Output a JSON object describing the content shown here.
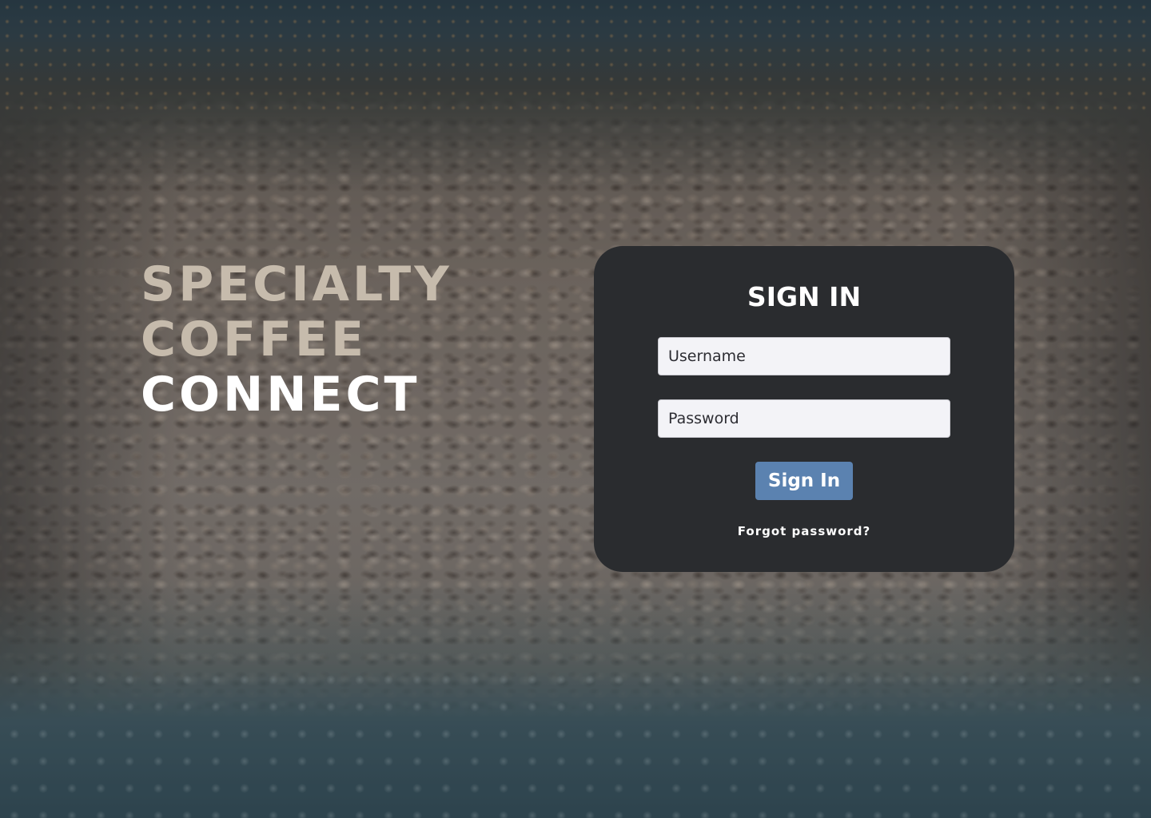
{
  "brand": {
    "line1": "SPECIALTY",
    "line2": "COFFEE",
    "line3": "CONNECT"
  },
  "login": {
    "title": "SIGN IN",
    "username_placeholder": "Username",
    "password_placeholder": "Password",
    "submit_label": "Sign In",
    "forgot_label": "Forgot password?"
  },
  "colors": {
    "card_background": "#2a2c2f",
    "button_background": "#5b82b0",
    "brand_muted": "#c6bbac",
    "brand_highlight": "#ffffff"
  }
}
